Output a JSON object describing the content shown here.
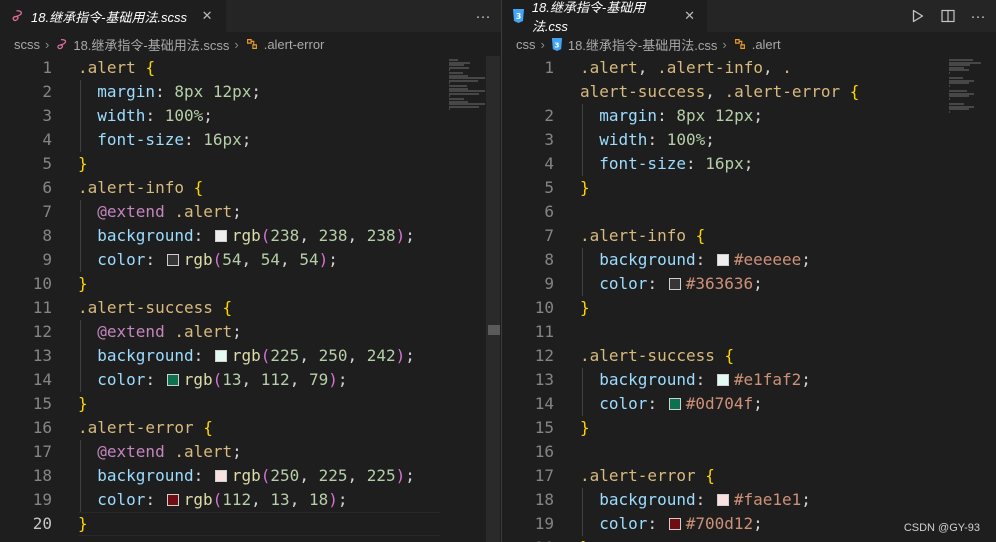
{
  "left": {
    "tab": {
      "label": "18.继承指令-基础用法.scss",
      "close": "✕",
      "file_icon": "sass-icon"
    },
    "actions": {
      "more": "···"
    },
    "breadcrumb": [
      "scss",
      "18.继承指令-基础用法.scss",
      ".alert-error"
    ],
    "current_line": 20,
    "lines": [
      {
        "n": 1,
        "tokens": [
          [
            "sel",
            ".alert"
          ],
          [
            "pu",
            " "
          ],
          [
            "br",
            "{"
          ]
        ]
      },
      {
        "n": 2,
        "tokens": [
          [
            "pr",
            "  margin"
          ],
          [
            "pu",
            ": "
          ],
          [
            "nm",
            "8px"
          ],
          [
            "pu",
            " "
          ],
          [
            "nm",
            "12px"
          ],
          [
            "pu",
            ";"
          ]
        ]
      },
      {
        "n": 3,
        "tokens": [
          [
            "pr",
            "  width"
          ],
          [
            "pu",
            ": "
          ],
          [
            "nm",
            "100%"
          ],
          [
            "pu",
            ";"
          ]
        ]
      },
      {
        "n": 4,
        "tokens": [
          [
            "pr",
            "  font-size"
          ],
          [
            "pu",
            ": "
          ],
          [
            "nm",
            "16px"
          ],
          [
            "pu",
            ";"
          ]
        ]
      },
      {
        "n": 5,
        "tokens": [
          [
            "br",
            "}"
          ]
        ]
      },
      {
        "n": 6,
        "tokens": [
          [
            "sel",
            ".alert-info"
          ],
          [
            "pu",
            " "
          ],
          [
            "br",
            "{"
          ]
        ]
      },
      {
        "n": 7,
        "tokens": [
          [
            "kw",
            "  @extend"
          ],
          [
            "pu",
            " "
          ],
          [
            "sel",
            ".alert"
          ],
          [
            "pu",
            ";"
          ]
        ]
      },
      {
        "n": 8,
        "tokens": [
          [
            "pr",
            "  background"
          ],
          [
            "pu",
            ": "
          ],
          [
            "swatch",
            "#eeeeee"
          ],
          [
            "fn",
            "rgb"
          ],
          [
            "br2",
            "("
          ],
          [
            "nm",
            "238"
          ],
          [
            "pu",
            ", "
          ],
          [
            "nm",
            "238"
          ],
          [
            "pu",
            ", "
          ],
          [
            "nm",
            "238"
          ],
          [
            "br2",
            ")"
          ],
          [
            "pu",
            ";"
          ]
        ]
      },
      {
        "n": 9,
        "tokens": [
          [
            "pr",
            "  color"
          ],
          [
            "pu",
            ": "
          ],
          [
            "swatch",
            "#363636"
          ],
          [
            "fn",
            "rgb"
          ],
          [
            "br2",
            "("
          ],
          [
            "nm",
            "54"
          ],
          [
            "pu",
            ", "
          ],
          [
            "nm",
            "54"
          ],
          [
            "pu",
            ", "
          ],
          [
            "nm",
            "54"
          ],
          [
            "br2",
            ")"
          ],
          [
            "pu",
            ";"
          ]
        ]
      },
      {
        "n": 10,
        "tokens": [
          [
            "br",
            "}"
          ]
        ]
      },
      {
        "n": 11,
        "tokens": [
          [
            "sel",
            ".alert-success"
          ],
          [
            "pu",
            " "
          ],
          [
            "br",
            "{"
          ]
        ]
      },
      {
        "n": 12,
        "tokens": [
          [
            "kw",
            "  @extend"
          ],
          [
            "pu",
            " "
          ],
          [
            "sel",
            ".alert"
          ],
          [
            "pu",
            ";"
          ]
        ]
      },
      {
        "n": 13,
        "tokens": [
          [
            "pr",
            "  background"
          ],
          [
            "pu",
            ": "
          ],
          [
            "swatch",
            "#e1faf2"
          ],
          [
            "fn",
            "rgb"
          ],
          [
            "br2",
            "("
          ],
          [
            "nm",
            "225"
          ],
          [
            "pu",
            ", "
          ],
          [
            "nm",
            "250"
          ],
          [
            "pu",
            ", "
          ],
          [
            "nm",
            "242"
          ],
          [
            "br2",
            ")"
          ],
          [
            "pu",
            ";"
          ]
        ]
      },
      {
        "n": 14,
        "tokens": [
          [
            "pr",
            "  color"
          ],
          [
            "pu",
            ": "
          ],
          [
            "swatch",
            "#0d704f"
          ],
          [
            "fn",
            "rgb"
          ],
          [
            "br2",
            "("
          ],
          [
            "nm",
            "13"
          ],
          [
            "pu",
            ", "
          ],
          [
            "nm",
            "112"
          ],
          [
            "pu",
            ", "
          ],
          [
            "nm",
            "79"
          ],
          [
            "br2",
            ")"
          ],
          [
            "pu",
            ";"
          ]
        ]
      },
      {
        "n": 15,
        "tokens": [
          [
            "br",
            "}"
          ]
        ]
      },
      {
        "n": 16,
        "tokens": [
          [
            "sel",
            ".alert-error"
          ],
          [
            "pu",
            " "
          ],
          [
            "br",
            "{"
          ]
        ]
      },
      {
        "n": 17,
        "tokens": [
          [
            "kw",
            "  @extend"
          ],
          [
            "pu",
            " "
          ],
          [
            "sel",
            ".alert"
          ],
          [
            "pu",
            ";"
          ]
        ]
      },
      {
        "n": 18,
        "tokens": [
          [
            "pr",
            "  background"
          ],
          [
            "pu",
            ": "
          ],
          [
            "swatch",
            "#fae1e1"
          ],
          [
            "fn",
            "rgb"
          ],
          [
            "br2",
            "("
          ],
          [
            "nm",
            "250"
          ],
          [
            "pu",
            ", "
          ],
          [
            "nm",
            "225"
          ],
          [
            "pu",
            ", "
          ],
          [
            "nm",
            "225"
          ],
          [
            "br2",
            ")"
          ],
          [
            "pu",
            ";"
          ]
        ]
      },
      {
        "n": 19,
        "tokens": [
          [
            "pr",
            "  color"
          ],
          [
            "pu",
            ": "
          ],
          [
            "swatch",
            "#700d12"
          ],
          [
            "fn",
            "rgb"
          ],
          [
            "br2",
            "("
          ],
          [
            "nm",
            "112"
          ],
          [
            "pu",
            ", "
          ],
          [
            "nm",
            "13"
          ],
          [
            "pu",
            ", "
          ],
          [
            "nm",
            "18"
          ],
          [
            "br2",
            ")"
          ],
          [
            "pu",
            ";"
          ]
        ]
      },
      {
        "n": 20,
        "tokens": [
          [
            "br",
            "}"
          ]
        ]
      }
    ]
  },
  "right": {
    "tab": {
      "label": "18.继承指令-基础用法.css",
      "close": "✕",
      "file_icon": "css-icon"
    },
    "actions": {
      "run": "run-icon",
      "split": "split-editor-icon",
      "more": "···"
    },
    "breadcrumb": [
      "css",
      "18.继承指令-基础用法.css",
      ".alert"
    ],
    "lines": [
      {
        "n": 1,
        "tokens": [
          [
            "sel",
            ".alert"
          ],
          [
            "pu",
            ", "
          ],
          [
            "sel",
            ".alert-info"
          ],
          [
            "pu",
            ", "
          ],
          [
            "sel",
            "."
          ]
        ]
      },
      {
        "n": "",
        "tokens": [
          [
            "sel",
            "alert-success"
          ],
          [
            "pu",
            ", "
          ],
          [
            "sel",
            ".alert-error"
          ],
          [
            "pu",
            " "
          ],
          [
            "br",
            "{"
          ]
        ]
      },
      {
        "n": 2,
        "tokens": [
          [
            "pr",
            "  margin"
          ],
          [
            "pu",
            ": "
          ],
          [
            "nm",
            "8px"
          ],
          [
            "pu",
            " "
          ],
          [
            "nm",
            "12px"
          ],
          [
            "pu",
            ";"
          ]
        ]
      },
      {
        "n": 3,
        "tokens": [
          [
            "pr",
            "  width"
          ],
          [
            "pu",
            ": "
          ],
          [
            "nm",
            "100%"
          ],
          [
            "pu",
            ";"
          ]
        ]
      },
      {
        "n": 4,
        "tokens": [
          [
            "pr",
            "  font-size"
          ],
          [
            "pu",
            ": "
          ],
          [
            "nm",
            "16px"
          ],
          [
            "pu",
            ";"
          ]
        ]
      },
      {
        "n": 5,
        "tokens": [
          [
            "br",
            "}"
          ]
        ]
      },
      {
        "n": 6,
        "tokens": []
      },
      {
        "n": 7,
        "tokens": [
          [
            "sel",
            ".alert-info"
          ],
          [
            "pu",
            " "
          ],
          [
            "br",
            "{"
          ]
        ]
      },
      {
        "n": 8,
        "tokens": [
          [
            "pr",
            "  background"
          ],
          [
            "pu",
            ": "
          ],
          [
            "swatch",
            "#eeeeee"
          ],
          [
            "st",
            "#eeeeee"
          ],
          [
            "pu",
            ";"
          ]
        ]
      },
      {
        "n": 9,
        "tokens": [
          [
            "pr",
            "  color"
          ],
          [
            "pu",
            ": "
          ],
          [
            "swatch",
            "#363636"
          ],
          [
            "st",
            "#363636"
          ],
          [
            "pu",
            ";"
          ]
        ]
      },
      {
        "n": 10,
        "tokens": [
          [
            "br",
            "}"
          ]
        ]
      },
      {
        "n": 11,
        "tokens": []
      },
      {
        "n": 12,
        "tokens": [
          [
            "sel",
            ".alert-success"
          ],
          [
            "pu",
            " "
          ],
          [
            "br",
            "{"
          ]
        ]
      },
      {
        "n": 13,
        "tokens": [
          [
            "pr",
            "  background"
          ],
          [
            "pu",
            ": "
          ],
          [
            "swatch",
            "#e1faf2"
          ],
          [
            "st",
            "#e1faf2"
          ],
          [
            "pu",
            ";"
          ]
        ]
      },
      {
        "n": 14,
        "tokens": [
          [
            "pr",
            "  color"
          ],
          [
            "pu",
            ": "
          ],
          [
            "swatch",
            "#0d704f"
          ],
          [
            "st",
            "#0d704f"
          ],
          [
            "pu",
            ";"
          ]
        ]
      },
      {
        "n": 15,
        "tokens": [
          [
            "br",
            "}"
          ]
        ]
      },
      {
        "n": 16,
        "tokens": []
      },
      {
        "n": 17,
        "tokens": [
          [
            "sel",
            ".alert-error"
          ],
          [
            "pu",
            " "
          ],
          [
            "br",
            "{"
          ]
        ]
      },
      {
        "n": 18,
        "tokens": [
          [
            "pr",
            "  background"
          ],
          [
            "pu",
            ": "
          ],
          [
            "swatch",
            "#fae1e1"
          ],
          [
            "st",
            "#fae1e1"
          ],
          [
            "pu",
            ";"
          ]
        ]
      },
      {
        "n": 19,
        "tokens": [
          [
            "pr",
            "  color"
          ],
          [
            "pu",
            ": "
          ],
          [
            "swatch",
            "#700d12"
          ],
          [
            "st",
            "#700d12"
          ],
          [
            "pu",
            ";"
          ]
        ]
      },
      {
        "n": 20,
        "tokens": [
          [
            "br",
            "}"
          ]
        ]
      }
    ]
  },
  "watermark": "CSDN @GY-93",
  "colors": {
    "editor_bg": "#1e1e1e",
    "selector": "#d7ba7d",
    "property": "#9cdcfe",
    "number": "#b5cea8",
    "keyword": "#c586c0",
    "function": "#dcdcaa",
    "string": "#ce9178",
    "bracket": "#ffd700"
  }
}
